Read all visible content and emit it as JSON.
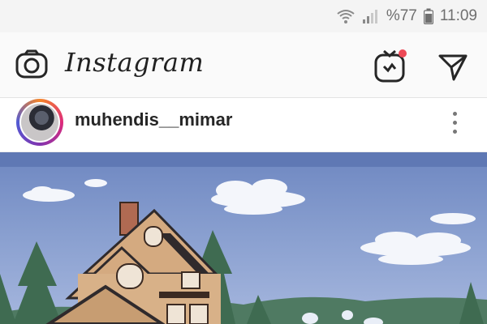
{
  "status_bar": {
    "battery_text": "%77",
    "time": "11:09",
    "icons": [
      "wifi-icon",
      "signal-icon",
      "battery-icon"
    ]
  },
  "header": {
    "app_title": "Instagram",
    "icons": [
      "camera-icon",
      "igtv-icon",
      "direct-message-icon"
    ],
    "igtv_notification_color": "#ed4956"
  },
  "post": {
    "username": "muhendis__mimar",
    "more_icon": "more-options-icon",
    "image_subject": "house-illustration"
  },
  "colors": {
    "sky": "#7e95c8",
    "text": "#262626",
    "header_bg": "#fafafa",
    "status_bg": "#f4f4f4"
  }
}
